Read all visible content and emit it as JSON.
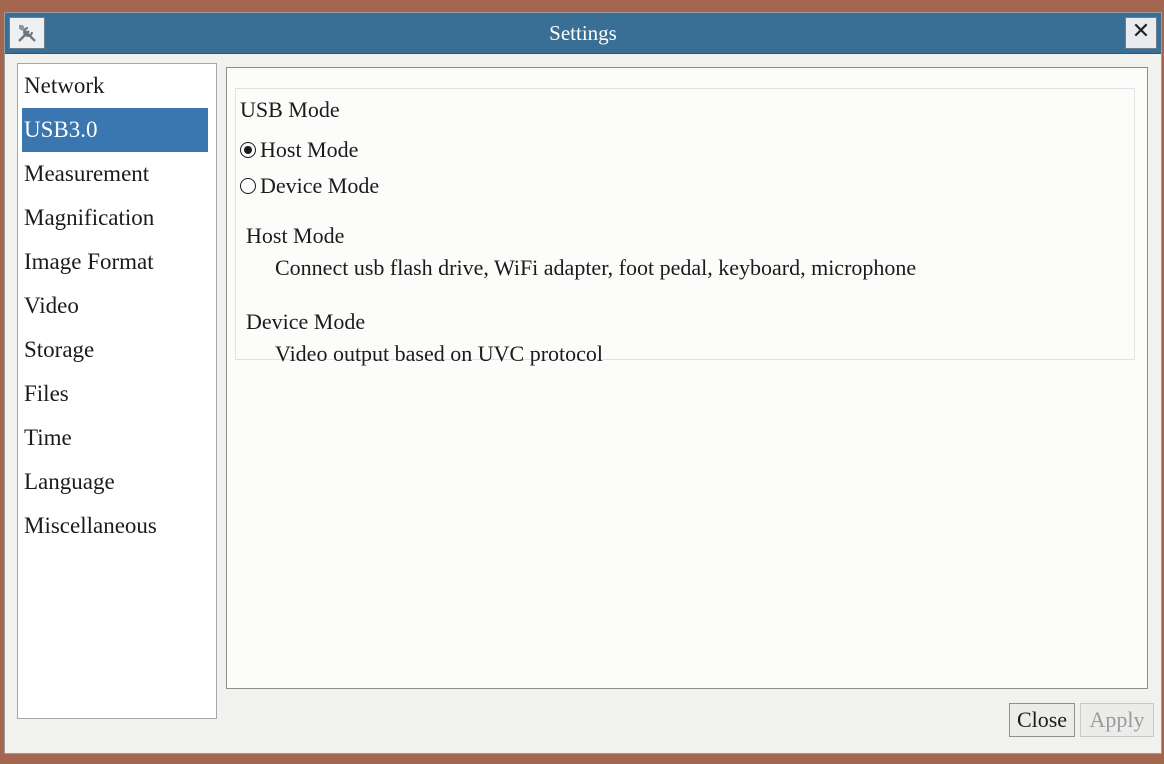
{
  "window": {
    "title": "Settings"
  },
  "icons": {
    "app": "tools-icon",
    "close": "close-icon"
  },
  "titlebar": {
    "close_glyph": "✕"
  },
  "sidebar": {
    "items": [
      {
        "label": "Network"
      },
      {
        "label": "USB3.0",
        "selected": true
      },
      {
        "label": "Measurement"
      },
      {
        "label": "Magnification"
      },
      {
        "label": "Image Format"
      },
      {
        "label": "Video"
      },
      {
        "label": "Storage"
      },
      {
        "label": "Files"
      },
      {
        "label": "Time"
      },
      {
        "label": "Language"
      },
      {
        "label": "Miscellaneous"
      }
    ]
  },
  "usb": {
    "group_title": "USB Mode",
    "options": [
      {
        "label": "Host Mode",
        "checked": true
      },
      {
        "label": "Device Mode",
        "checked": false
      }
    ],
    "descriptions": [
      {
        "title": "Host Mode",
        "text": "Connect usb flash drive, WiFi adapter, foot pedal, keyboard, microphone"
      },
      {
        "title": "Device Mode",
        "text": "Video output based on UVC protocol"
      }
    ]
  },
  "buttons": {
    "close": "Close",
    "apply": "Apply"
  },
  "colors": {
    "titlebar": "#3a6f95",
    "selection": "#3a77b0"
  }
}
